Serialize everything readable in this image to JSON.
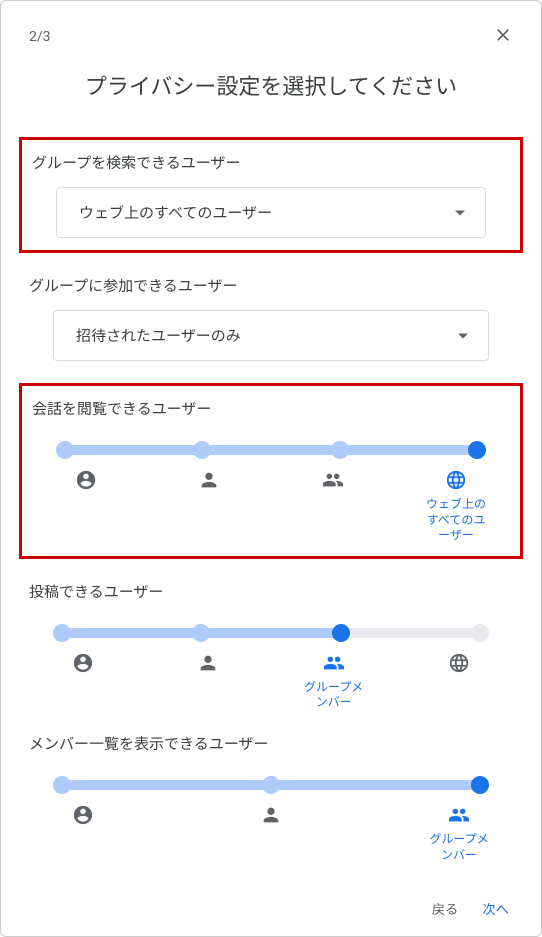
{
  "step": "2/3",
  "title": "プライバシー設定を選択してください",
  "sections": {
    "search": {
      "label": "グループを検索できるユーザー",
      "value": "ウェブ上のすべてのユーザー",
      "highlighted": true
    },
    "join": {
      "label": "グループに参加できるユーザー",
      "value": "招待されたユーザーのみ",
      "highlighted": false
    },
    "view": {
      "label": "会話を閲覧できるユーザー",
      "selected_index": 3,
      "max_index": 3,
      "selected_caption": "ウェブ上のすべてのユーザー",
      "highlighted": true
    },
    "post": {
      "label": "投稿できるユーザー",
      "selected_index": 2,
      "max_index": 3,
      "selected_caption": "グループメンバー",
      "highlighted": false
    },
    "members": {
      "label": "メンバー一覧を表示できるユーザー",
      "selected_index": 2,
      "max_index": 2,
      "selected_caption": "グループメンバー",
      "highlighted": false
    }
  },
  "footer": {
    "back": "戻る",
    "next": "次へ"
  }
}
